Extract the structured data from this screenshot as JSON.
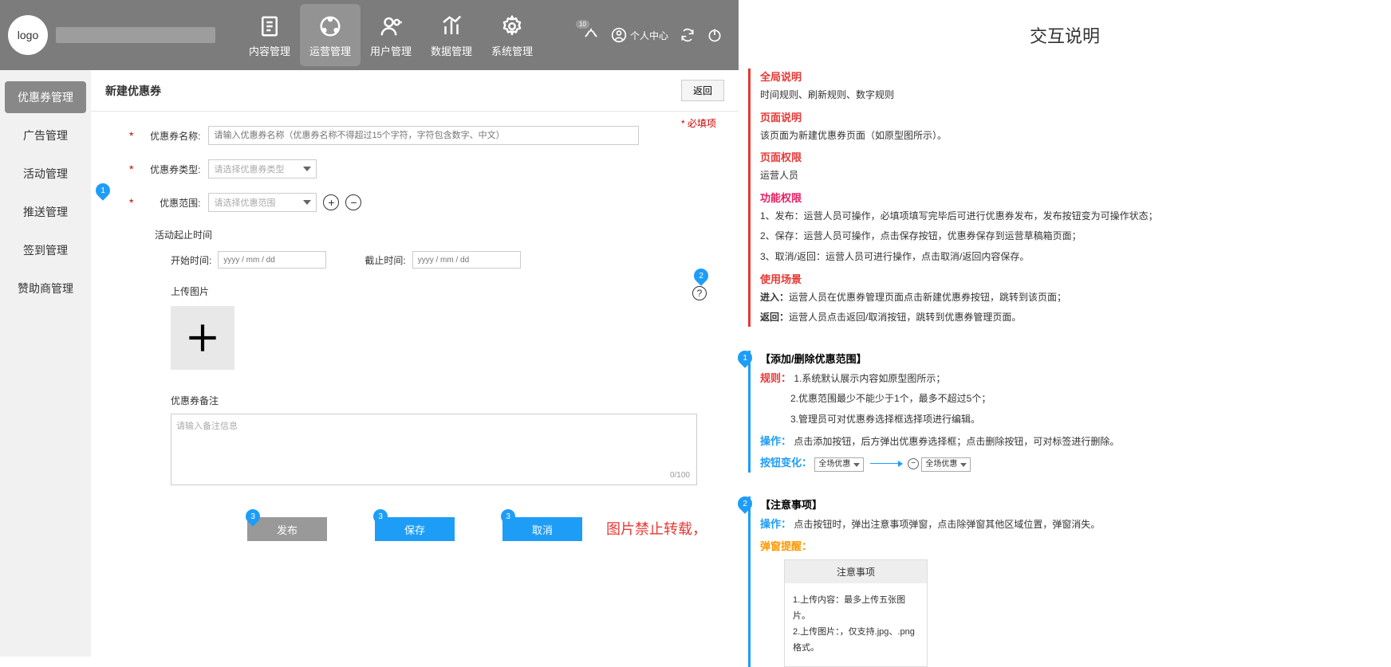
{
  "logo_text": "logo",
  "nav": [
    {
      "label": "内容管理",
      "icon": "doc"
    },
    {
      "label": "运营管理",
      "icon": "ops",
      "active": true
    },
    {
      "label": "用户管理",
      "icon": "user"
    },
    {
      "label": "数据管理",
      "icon": "chart"
    },
    {
      "label": "系统管理",
      "icon": "gear"
    }
  ],
  "header_badge": "10",
  "header_user_label": "个人中心",
  "sidebar": [
    {
      "label": "优惠券管理",
      "active": true
    },
    {
      "label": "广告管理"
    },
    {
      "label": "活动管理"
    },
    {
      "label": "推送管理"
    },
    {
      "label": "签到管理"
    },
    {
      "label": "赞助商管理"
    }
  ],
  "page_title": "新建优惠券",
  "back_btn": "返回",
  "required_note": "必填项",
  "form": {
    "name_label": "优惠券名称:",
    "name_placeholder": "请输入优惠券名称（优惠券名称不得超过15个字符，字符包含数字、中文）",
    "type_label": "优惠券类型:",
    "type_placeholder": "请选择优惠券类型",
    "scope_label": "优惠范围:",
    "scope_placeholder": "请选择优惠范围",
    "time_section": "活动起止时间",
    "start_label": "开始时间:",
    "end_label": "截止时间:",
    "date_placeholder": "yyyy / mm / dd",
    "upload_label": "上传图片",
    "remark_label": "优惠券备注",
    "remark_placeholder": "请输入备注信息",
    "remark_count": "0/100"
  },
  "buttons": {
    "publish": "发布",
    "save": "保存",
    "cancel": "取消"
  },
  "watermark": "图片禁止转载，",
  "doc": {
    "title": "交互说明",
    "global_h": "全局说明",
    "global_p": "时间规则、刷新规则、数字规则",
    "page_h": "页面说明",
    "page_p": "该页面为新建优惠券页面（如原型图所示）。",
    "perm_h": "页面权限",
    "perm_p": "运营人员",
    "func_h": "功能权限",
    "func_1": "1、发布：运营人员可操作，必填项填写完毕后可进行优惠券发布，发布按钮变为可操作状态；",
    "func_2": "2、保存：运营人员可操作，点击保存按钮，优惠券保存到运营草稿箱页面；",
    "func_3": "3、取消/返回：运营人员可进行操作，点击取消/返回内容保存。",
    "scene_h": "使用场景",
    "scene_1": "进入：运营人员在优惠券管理页面点击新建优惠券按钮，跳转到该页面；",
    "scene_2": "返回：运营人员点击返回/取消按钮，跳转到优惠券管理页面。",
    "sec1_title": "【添加/删除优惠范围】",
    "sec1_rule_h": "规则：",
    "sec1_rule_1": "1.系统默认展示内容如原型图所示；",
    "sec1_rule_2": "2.优惠范围最少不能少于1个，最多不超过5个；",
    "sec1_rule_3": "3.管理员可对优惠券选择框选择项进行编辑。",
    "sec1_op_h": "操作：",
    "sec1_op_p": "点击添加按钮，后方弹出优惠券选择框；点击删除按钮，可对标签进行删除。",
    "sec1_btn_h": "按钮变化：",
    "sec1_sel1": "全场优惠",
    "sec1_sel2": "全场优惠",
    "sec2_title": "【注意事项】",
    "sec2_op_h": "操作：",
    "sec2_op_p": "点击按钮时，弹出注意事项弹窗，点击除弹窗其他区域位置，弹窗消失。",
    "sec2_tip_h": "弹窗提醒：",
    "tip_title": "注意事项",
    "tip_1": "1.上传内容：最多上传五张图片。",
    "tip_2": "2.上传图片：，仅支持.jpg、.png 格式。"
  }
}
